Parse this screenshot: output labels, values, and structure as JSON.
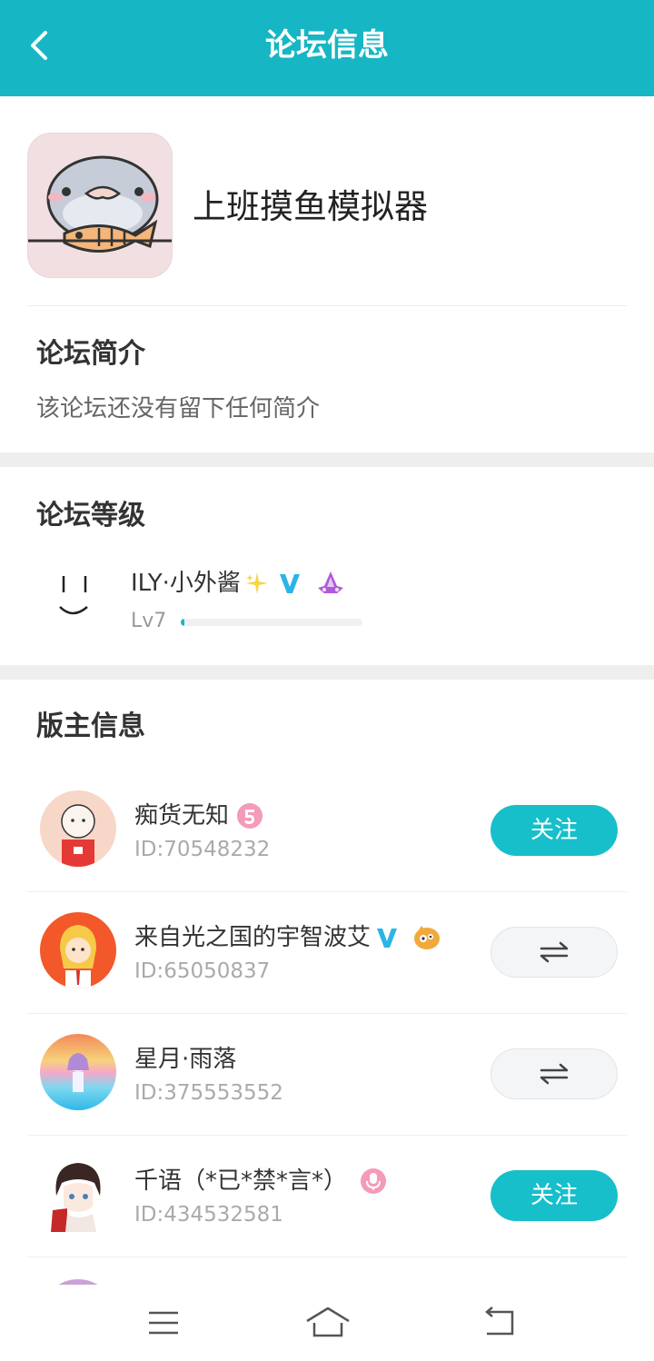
{
  "header": {
    "title": "论坛信息",
    "back_icon": "chevron-left-icon"
  },
  "forum": {
    "name": "上班摸鱼模拟器",
    "intro_title": "论坛简介",
    "intro_text": "该论坛还没有留下任何简介"
  },
  "level": {
    "title": "论坛等级",
    "user_name": "ILY·小外酱",
    "badges": [
      "sparkle-icon",
      "verified-v-icon",
      "rank-emblem-icon"
    ],
    "level_label": "Lv7",
    "progress": 0.02
  },
  "moderators": {
    "title": "版主信息",
    "items": [
      {
        "name": "痴货无知",
        "id": "ID:70548232",
        "badge": "pink-level-5-icon",
        "action": "follow",
        "action_label": "关注"
      },
      {
        "name": "来自光之国的宇智波艾",
        "id": "ID:65050837",
        "badge": "verified-v-and-emoji-icon",
        "action": "swap",
        "action_label": ""
      },
      {
        "name": "星月·雨落",
        "id": "ID:375553552",
        "badge": "",
        "action": "swap",
        "action_label": ""
      },
      {
        "name": "千语（*已*禁*言*）",
        "id": "ID:434532581",
        "badge": "pink-mic-icon",
        "action": "follow",
        "action_label": "关注"
      }
    ]
  },
  "navbar": {
    "items": [
      "menu-icon",
      "home-icon",
      "back-icon"
    ]
  },
  "colors": {
    "accent": "#17b6c4",
    "button": "#17bfca",
    "gap": "#eeeeee"
  }
}
